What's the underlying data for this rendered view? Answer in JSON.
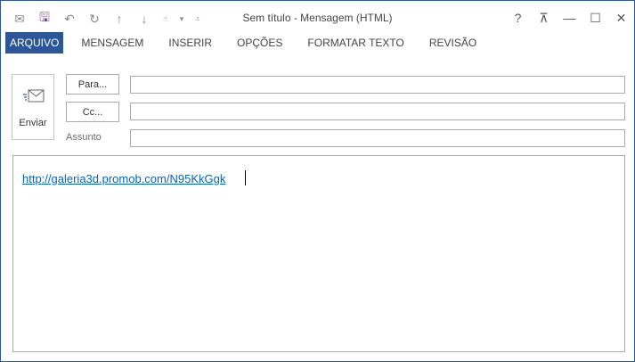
{
  "window": {
    "title": "Sem título - Mensagem (HTML)",
    "accent_color": "#2b579a",
    "controls": {
      "help": "?",
      "ribbon_options": "⊼",
      "minimize": "—",
      "maximize": "☐",
      "close": "✕"
    }
  },
  "quick_access": [
    {
      "name": "message-icon",
      "glyph": "✉"
    },
    {
      "name": "save-icon",
      "glyph": "🖫"
    },
    {
      "name": "undo-icon",
      "glyph": "↶"
    },
    {
      "name": "redo-icon",
      "glyph": "↻"
    },
    {
      "name": "up-arrow-icon",
      "glyph": "↑"
    },
    {
      "name": "down-arrow-icon",
      "glyph": "↓"
    },
    {
      "name": "touch-mode-icon",
      "glyph": "☝"
    },
    {
      "name": "dropdown-icon",
      "glyph": "▾"
    },
    {
      "name": "customize-icon",
      "glyph": "⩡"
    }
  ],
  "ribbon": {
    "tabs": [
      "ARQUIVO",
      "MENSAGEM",
      "INSERIR",
      "OPÇÕES",
      "FORMATAR TEXTO",
      "REVISÃO"
    ],
    "active_tab": "ARQUIVO"
  },
  "compose": {
    "send_label": "Enviar",
    "to_button": "Para...",
    "cc_button": "Cc...",
    "subject_label": "Assunto",
    "to_value": "",
    "cc_value": "",
    "subject_value": ""
  },
  "body": {
    "link_text": "http://galeria3d.promob.com/N95KkGgk",
    "link_color": "#0563c1"
  }
}
